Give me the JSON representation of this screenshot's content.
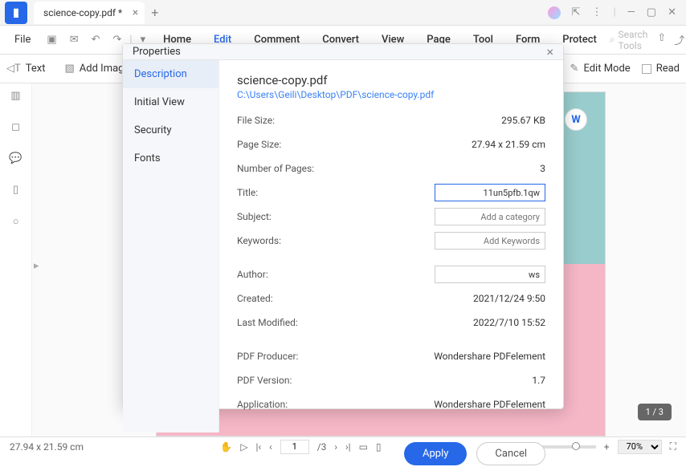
{
  "tab": {
    "title": "science-copy.pdf *"
  },
  "menu": {
    "file": "File",
    "items": [
      "Home",
      "Edit",
      "Comment",
      "Convert",
      "View",
      "Page",
      "Tool",
      "Form",
      "Protect"
    ],
    "active_index": 1,
    "search_placeholder": "Search Tools"
  },
  "subbar": {
    "text": "T Text",
    "add_image": "Add Image",
    "edit_mode": "Edit Mode",
    "read": "Read"
  },
  "page_indicator": "1 / 3",
  "status": {
    "page_size": "27.94 x 21.59 cm",
    "page_current": "1",
    "page_total": "/3",
    "zoom": "70%"
  },
  "modal": {
    "title": "Properties",
    "sidebar": [
      "Description",
      "Initial View",
      "Security",
      "Fonts"
    ],
    "active_sidebar": 0,
    "content": {
      "file_name": "science-copy.pdf",
      "file_path": "C:\\Users\\Geili\\Desktop\\PDF\\science-copy.pdf",
      "rows": {
        "file_size_label": "File Size:",
        "file_size_value": "295.67 KB",
        "page_size_label": "Page Size:",
        "page_size_value": "27.94 x 21.59 cm",
        "num_pages_label": "Number of Pages:",
        "num_pages_value": "3",
        "title_label": "Title:",
        "title_value": "11un5pfb.1qw",
        "subject_label": "Subject:",
        "subject_placeholder": "Add a category",
        "keywords_label": "Keywords:",
        "keywords_placeholder": "Add Keywords",
        "author_label": "Author:",
        "author_value": "ws",
        "created_label": "Created:",
        "created_value": "2021/12/24 9:50",
        "modified_label": "Last Modified:",
        "modified_value": "2022/7/10 15:52",
        "producer_label": "PDF Producer:",
        "producer_value": "Wondershare PDFelement",
        "version_label": "PDF Version:",
        "version_value": "1.7",
        "application_label": "Application:",
        "application_value": "Wondershare PDFelement"
      }
    },
    "buttons": {
      "apply": "Apply",
      "cancel": "Cancel"
    }
  }
}
